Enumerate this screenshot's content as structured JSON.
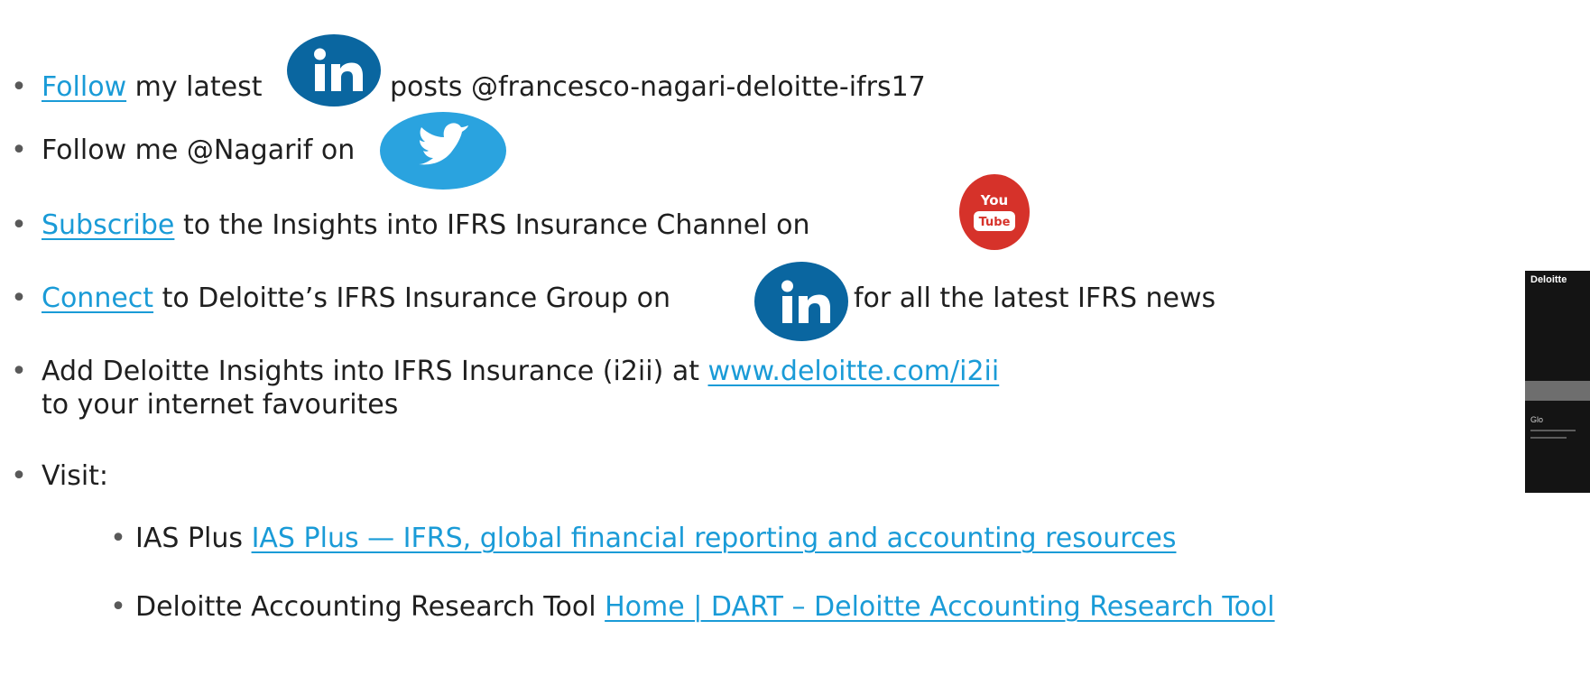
{
  "items": [
    {
      "link": "Follow",
      "before": "",
      "after": " my latest",
      "tail": "posts @francesco-nagari-deloitte-ifrs17",
      "icon": "linkedin-icon"
    },
    {
      "text": "Follow me @Nagarif on",
      "icon": "twitter-icon"
    },
    {
      "link": "Subscribe",
      "after": " to the Insights into IFRS Insurance Channel on",
      "icon": "youtube-icon"
    },
    {
      "link": "Connect",
      "after": " to Deloitte’s IFRS Insurance Group on",
      "tail": "for all the latest IFRS news",
      "icon": "linkedin-icon"
    },
    {
      "text": "Add Deloitte Insights into IFRS Insurance (i2ii) at ",
      "link": "www.deloitte.com/i2ii",
      "line2": "to your internet favourites"
    },
    {
      "text": "Visit:"
    }
  ],
  "subitems": [
    {
      "text": "IAS Plus ",
      "link": "IAS Plus — IFRS, global financial reporting and accounting resources"
    },
    {
      "text": "Deloitte Accounting Research Tool ",
      "link": "Home | DART – Deloitte Accounting Research Tool"
    }
  ],
  "bullet": "•",
  "youtube": {
    "top": "You",
    "bottom": "Tube"
  },
  "thumbnail": {
    "brand": "Deloitte",
    "caption": "Glo"
  },
  "colors": {
    "link": "#1a9bd7",
    "linkedin": "#0a66a0",
    "twitter": "#2aa3df",
    "youtube": "#d6322a"
  }
}
